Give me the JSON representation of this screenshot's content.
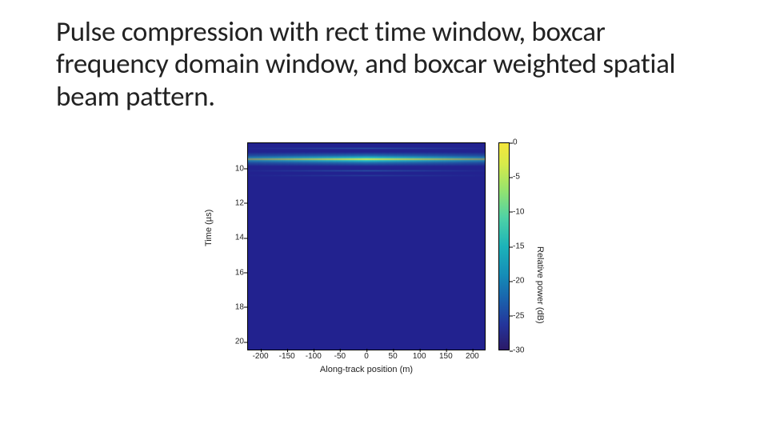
{
  "title": "Pulse compression with rect time window, boxcar frequency domain window, and boxcar weighted spatial beam pattern.",
  "chart_data": {
    "type": "heatmap",
    "xlabel": "Along-track position (m)",
    "ylabel": "Time (µs)",
    "clabel": "Relative power (dB)",
    "x_ticks": [
      -200,
      -150,
      -100,
      -50,
      0,
      50,
      100,
      150,
      200
    ],
    "y_ticks": [
      10,
      12,
      14,
      16,
      18,
      20
    ],
    "c_ticks": [
      0,
      -5,
      -10,
      -15,
      -20,
      -25,
      -30
    ],
    "xlim": [
      -225,
      225
    ],
    "ylim": [
      8.5,
      20.5
    ],
    "clim": [
      -30,
      0
    ],
    "description": "Pulse-compression response: a single bright horizontal return near Time ≈ 9 µs spanning all along-track positions, brightest (≈0 dB) near center and fading toward edges; background elsewhere is near -30 dB.",
    "main_return": {
      "time_us": 9,
      "peak_db": 0,
      "edge_db": -15,
      "extent_x": [
        -225,
        225
      ]
    }
  },
  "colors": {
    "bg_low": "#22228f",
    "high": "#f5e63b"
  }
}
